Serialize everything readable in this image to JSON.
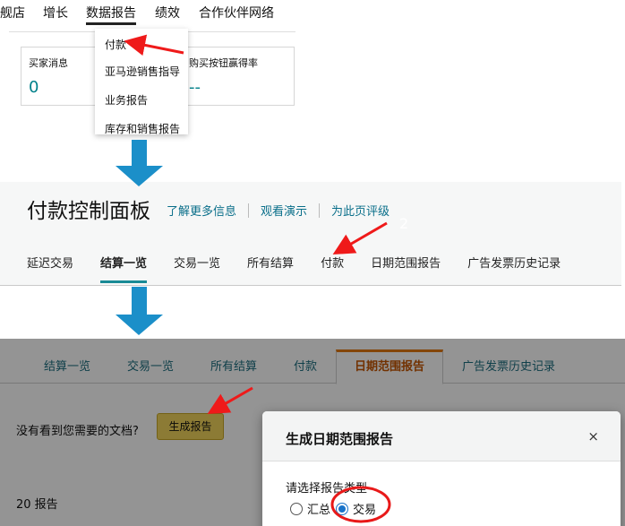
{
  "panel1": {
    "nav": [
      "舰店",
      "增长",
      "数据报告",
      "绩效",
      "合作伙伴网络"
    ],
    "active_nav": 2,
    "dropdown": [
      "付款",
      "亚马逊销售指导",
      "业务报告",
      "库存和销售报告"
    ],
    "cards": [
      {
        "title": "买家消息",
        "value": "0"
      },
      {
        "title": "购买按钮赢得率",
        "value": "--"
      }
    ]
  },
  "panel2": {
    "title": "付款控制面板",
    "links": [
      "了解更多信息",
      "观看演示",
      "为此页评级"
    ],
    "badge": "2",
    "tabs": [
      "延迟交易",
      "结算一览",
      "交易一览",
      "所有结算",
      "付款",
      "日期范围报告",
      "广告发票历史记录"
    ],
    "active_tab": 1
  },
  "panel3": {
    "tabs": [
      "结算一览",
      "交易一览",
      "所有结算",
      "付款",
      "日期范围报告",
      "广告发票历史记录"
    ],
    "active_tab": 4,
    "prompt": "没有看到您需要的文档?",
    "generate_button": "生成报告",
    "count": "20 报告",
    "modal": {
      "title": "生成日期范围报告",
      "close": "×",
      "label": "请选择报告类型",
      "options": [
        "汇总",
        "交易"
      ],
      "selected": 1
    }
  },
  "colors": {
    "annotation_red": "#ef1a1a",
    "flow_arrow": "#1b8fc9",
    "tab_accent": "#1a8a96",
    "active_orange": "#e47911"
  }
}
